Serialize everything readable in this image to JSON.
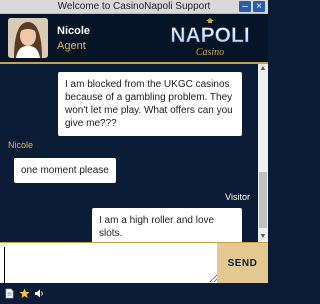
{
  "window": {
    "title": "Welcome to CasinoNapoli Support"
  },
  "agent": {
    "name": "Nicole",
    "role": "Agent"
  },
  "brand": {
    "logo_text": "NAPOLI",
    "logo_sub": "Casino",
    "accent": "#c9a23f",
    "background": "#0b1d36"
  },
  "messages": [
    {
      "text": "I am blocked from the UKGC casinos because of a gambling problem. They won't let me play. What offers can you give me???"
    },
    {
      "sender": "Nicole",
      "text": "one moment please"
    },
    {
      "sender": "Visitor",
      "text": "I am a high roller and love slots."
    }
  ],
  "composer": {
    "value": "",
    "placeholder": "",
    "send_label": "SEND"
  },
  "footer": {
    "icons": [
      "document-icon",
      "star-icon",
      "volume-icon"
    ]
  }
}
